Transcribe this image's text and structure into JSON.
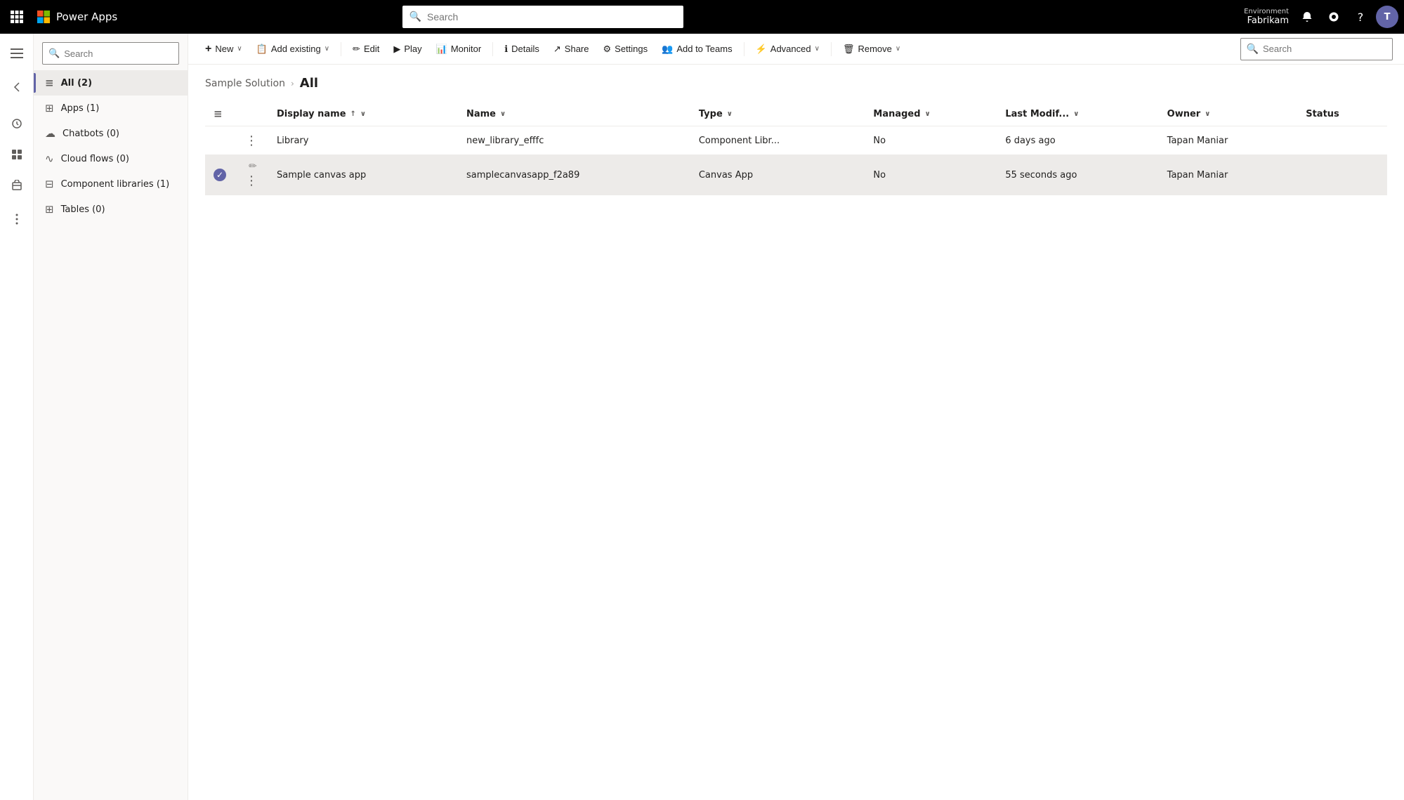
{
  "topbar": {
    "appname": "Power Apps",
    "search_placeholder": "Search",
    "environment_label": "Environment",
    "environment_name": "Fabrikam"
  },
  "sidebar": {
    "search_placeholder": "Search",
    "items": [
      {
        "id": "all",
        "label": "All  (2)",
        "icon": "≡",
        "active": true
      },
      {
        "id": "apps",
        "label": "Apps  (1)",
        "icon": "⊞"
      },
      {
        "id": "chatbots",
        "label": "Chatbots  (0)",
        "icon": "☁"
      },
      {
        "id": "cloudflows",
        "label": "Cloud flows  (0)",
        "icon": "∿"
      },
      {
        "id": "componentlibs",
        "label": "Component libraries  (1)",
        "icon": "⊟"
      },
      {
        "id": "tables",
        "label": "Tables  (0)",
        "icon": "⊞"
      }
    ]
  },
  "commandbar": {
    "new_label": "New",
    "add_existing_label": "Add existing",
    "edit_label": "Edit",
    "play_label": "Play",
    "monitor_label": "Monitor",
    "details_label": "Details",
    "share_label": "Share",
    "settings_label": "Settings",
    "add_to_teams_label": "Add to Teams",
    "advanced_label": "Advanced",
    "remove_label": "Remove",
    "search_placeholder": "Search"
  },
  "breadcrumb": {
    "parent": "Sample Solution",
    "current": "All"
  },
  "table": {
    "columns": [
      {
        "id": "display_name",
        "label": "Display name",
        "sortable": true,
        "sort": "asc"
      },
      {
        "id": "name",
        "label": "Name",
        "sortable": true
      },
      {
        "id": "type",
        "label": "Type",
        "sortable": true
      },
      {
        "id": "managed",
        "label": "Managed",
        "sortable": true
      },
      {
        "id": "last_modified",
        "label": "Last Modif...",
        "sortable": true
      },
      {
        "id": "owner",
        "label": "Owner",
        "sortable": true
      },
      {
        "id": "status",
        "label": "Status",
        "sortable": false
      }
    ],
    "rows": [
      {
        "id": "library",
        "display_name": "Library",
        "name": "new_library_efffc",
        "type": "Component Libr...",
        "managed": "No",
        "last_modified": "6 days ago",
        "owner": "Tapan Maniar",
        "status": "",
        "selected": false,
        "has_check_icon": false
      },
      {
        "id": "sample-canvas-app",
        "display_name": "Sample canvas app",
        "name": "samplecanvasapp_f2a89",
        "type": "Canvas App",
        "managed": "No",
        "last_modified": "55 seconds ago",
        "owner": "Tapan Maniar",
        "status": "",
        "selected": true,
        "has_check_icon": true
      }
    ]
  },
  "icons": {
    "waffle": "⊞",
    "back": "←",
    "home": "⌂",
    "notifications": "🔔",
    "settings": "⚙",
    "help": "?",
    "search": "🔍",
    "new": "+",
    "add": "📋",
    "edit": "✏",
    "play": "▶",
    "monitor": "📊",
    "details": "ℹ",
    "share": "↗",
    "gear": "⚙",
    "teams": "👥",
    "advanced": "⚡",
    "remove": "🗑",
    "check": "✓",
    "ellipsis": "⋮",
    "sort_asc": "↑",
    "chevron_down": "∨"
  }
}
